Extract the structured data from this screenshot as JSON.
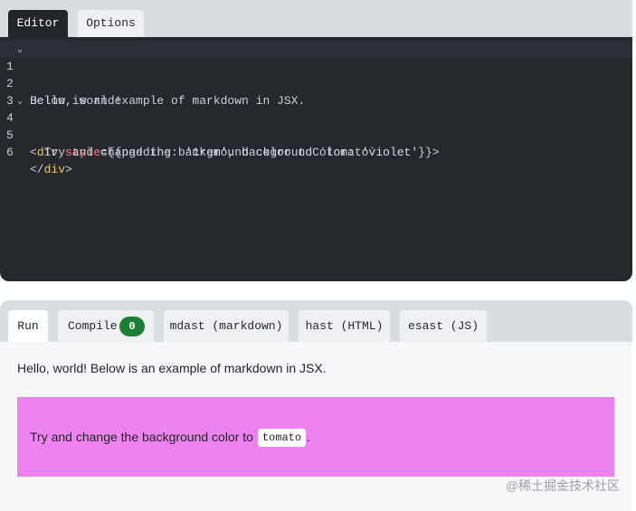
{
  "editor": {
    "tabs": [
      {
        "label": "Editor",
        "active": true
      },
      {
        "label": "Options",
        "active": false
      }
    ],
    "lines": [
      {
        "number": "1",
        "fold": "⌄",
        "text": "Hello, world!"
      },
      {
        "number": "2",
        "fold": "",
        "text": "Below is an example of markdown in JSX."
      },
      {
        "number": "3",
        "fold": "",
        "text": ""
      },
      {
        "number": "4",
        "fold": "⌄",
        "tokens": {
          "lt": "<",
          "tag": "div",
          "attr": "style",
          "open": "={{",
          "key1": "padding:",
          "val1": "'1rem'",
          "comma": ", ",
          "key2": "backgroundColor:",
          "val2": "'violet'",
          "close": "}}>"
        }
      },
      {
        "number": "5",
        "fold": "",
        "text": "  Try and change the background color to `tomato`."
      },
      {
        "number": "6",
        "fold": "",
        "tokens": {
          "lt": "</",
          "tag": "div",
          "gt": ">"
        }
      }
    ]
  },
  "output": {
    "tabs": [
      {
        "label": "Run",
        "active": true
      },
      {
        "label": "Compile",
        "badge": "0",
        "active": false
      },
      {
        "label": "mdast (markdown)",
        "active": false
      },
      {
        "label": "hast (HTML)",
        "active": false
      },
      {
        "label": "esast (JS)",
        "active": false
      }
    ],
    "preview": {
      "paragraph": "Hello, world! Below is an example of markdown in JSX.",
      "box_text_before": "Try and change the background color to ",
      "box_code": "tomato",
      "box_text_after": ".",
      "box_color": "#ee82ee"
    }
  },
  "watermark": "@稀土掘金技术社区",
  "colors": {
    "badge_green": "#1a7f37",
    "editor_bg": "#25282d"
  }
}
